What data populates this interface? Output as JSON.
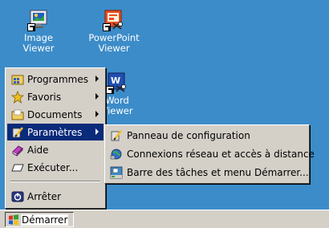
{
  "desktop": {
    "icons": [
      {
        "line1": "Image",
        "line2": "Viewer"
      },
      {
        "line1": "PowerPoint",
        "line2": "Viewer"
      },
      {
        "line1": "Word",
        "line2": "Viewer"
      }
    ]
  },
  "start_menu": {
    "items": [
      {
        "label": "Programmes",
        "icon": "programs-folder-icon",
        "has_submenu": true
      },
      {
        "label": "Favoris",
        "icon": "favorites-star-icon",
        "has_submenu": true
      },
      {
        "label": "Documents",
        "icon": "documents-folder-icon",
        "has_submenu": true
      },
      {
        "label": "Paramètres",
        "icon": "settings-icon",
        "has_submenu": true,
        "selected": true
      },
      {
        "label": "Aide",
        "icon": "help-book-icon",
        "has_submenu": false
      },
      {
        "label": "Exécuter...",
        "icon": "run-icon",
        "has_submenu": false
      },
      {
        "label": "Arrêter",
        "icon": "shutdown-icon",
        "has_submenu": false
      }
    ]
  },
  "settings_submenu": {
    "items": [
      {
        "label": "Panneau de configuration",
        "icon": "control-panel-icon"
      },
      {
        "label": "Connexions réseau et accès à distance",
        "icon": "network-connections-icon"
      },
      {
        "label": "Barre des tâches et menu Démarrer...",
        "icon": "taskbar-icon"
      }
    ]
  },
  "taskbar": {
    "start_label": "Démarrer"
  },
  "colors": {
    "desktop": "#3c8cc9",
    "menu_face": "#d4d0c8",
    "selection": "#0a2a7a"
  }
}
